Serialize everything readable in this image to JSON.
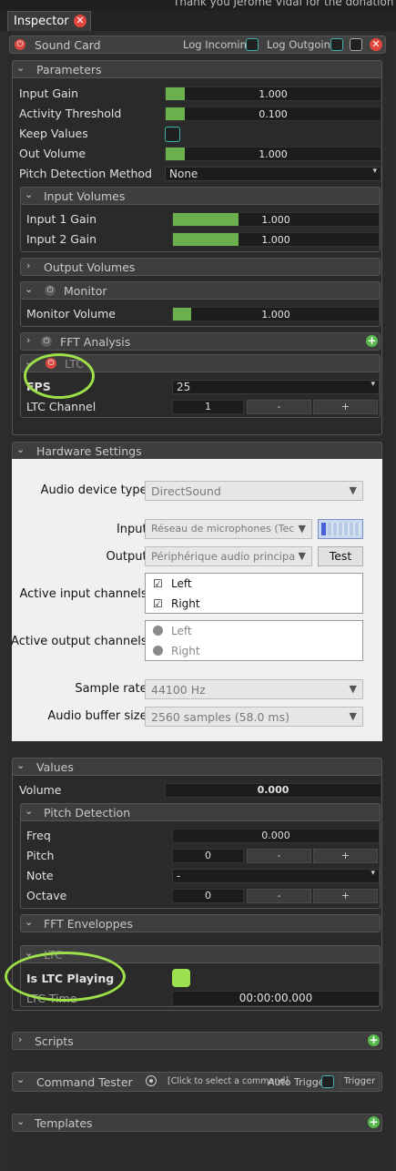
{
  "top_notice": "Thank you Jérome Vidal for the donation !",
  "tab": {
    "label": "Inspector"
  },
  "sound_card": {
    "title": "Sound Card",
    "log_incoming": "Log Incoming",
    "log_outgoing": "Log Outgoing"
  },
  "parameters": {
    "title": "Parameters",
    "input_gain": {
      "label": "Input Gain",
      "value": "1.000",
      "fill": 0.09
    },
    "activity_threshold": {
      "label": "Activity Threshold",
      "value": "0.100",
      "fill": 0.09
    },
    "keep_values": {
      "label": "Keep Values"
    },
    "out_volume": {
      "label": "Out Volume",
      "value": "1.000",
      "fill": 0.09
    },
    "pitch_method": {
      "label": "Pitch Detection Method",
      "value": "None"
    }
  },
  "input_volumes": {
    "title": "Input Volumes",
    "input1": {
      "label": "Input 1 Gain",
      "value": "1.000",
      "fill": 0.32
    },
    "input2": {
      "label": "Input 2 Gain",
      "value": "1.000",
      "fill": 0.32
    }
  },
  "output_volumes": {
    "title": "Output Volumes"
  },
  "monitor": {
    "title": "Monitor",
    "volume": {
      "label": "Monitor Volume",
      "value": "1.000",
      "fill": 0.09
    }
  },
  "fft_analysis": {
    "title": "FFT Analysis"
  },
  "ltc": {
    "title": "LTC",
    "fps": {
      "label": "FPS",
      "value": "25"
    },
    "channel": {
      "label": "LTC Channel",
      "value": "1",
      "minus": "-",
      "plus": "+"
    }
  },
  "hardware": {
    "title": "Hardware Settings",
    "device_type": {
      "label": "Audio device type:",
      "value": "DirectSound"
    },
    "input": {
      "label": "Input:",
      "value": "Réseau de microphones (Techn..."
    },
    "output": {
      "label": "Output:",
      "value": "Périphérique audio principal",
      "test": "Test"
    },
    "active_input": {
      "label": "Active input channels:",
      "items": [
        "Left",
        "Right"
      ]
    },
    "active_output": {
      "label": "Active output channels:",
      "items": [
        "Left",
        "Right"
      ]
    },
    "sample_rate": {
      "label": "Sample rate:",
      "value": "44100 Hz"
    },
    "buffer_size": {
      "label": "Audio buffer size:",
      "value": "2560 samples (58.0 ms)"
    }
  },
  "values": {
    "title": "Values",
    "volume": {
      "label": "Volume",
      "value": "0.000"
    },
    "pitch_detection": {
      "title": "Pitch Detection",
      "freq": {
        "label": "Freq",
        "value": "0.000"
      },
      "pitch": {
        "label": "Pitch",
        "value": "0",
        "minus": "-",
        "plus": "+"
      },
      "note": {
        "label": "Note",
        "value": "-"
      },
      "octave": {
        "label": "Octave",
        "value": "0",
        "minus": "-",
        "plus": "+"
      }
    },
    "fft_enveloppes": {
      "title": "FFT Enveloppes"
    },
    "ltc": {
      "title": "LTC",
      "is_playing": {
        "label": "Is LTC Playing"
      },
      "time": {
        "label": "LTC Time",
        "value": "00:00:00.000"
      }
    }
  },
  "scripts": {
    "title": "Scripts"
  },
  "command_tester": {
    "title": "Command Tester",
    "command": "[Click to select a command]",
    "auto_trigger": "Auto Trigger",
    "trigger": "Trigger"
  },
  "templates": {
    "title": "Templates"
  },
  "colors": {
    "accent_green": "#6ab04c",
    "power_red": "#d7473f",
    "highlight_ring": "#9ee04a",
    "check_teal": "#3fb3a8"
  }
}
